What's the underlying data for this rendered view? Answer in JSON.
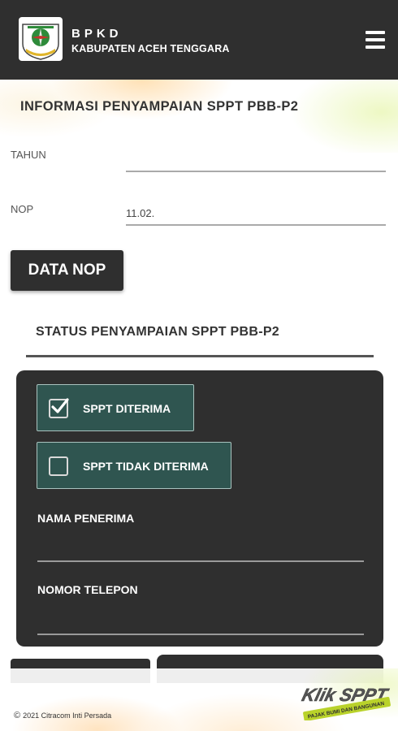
{
  "header": {
    "brand_line1": "BPKD",
    "brand_line2": "KABUPATEN ACEH TENGGARA",
    "logo_icon": "regency-emblem-icon",
    "menu_icon": "hamburger-menu-icon"
  },
  "page": {
    "title": "INFORMASI PENYAMPAIAN SPPT PBB-P2"
  },
  "form": {
    "tahun_label": "TAHUN",
    "tahun_value": "",
    "nop_label": "NOP",
    "nop_value": "11.02.",
    "data_nop_button": "DATA NOP"
  },
  "status": {
    "title": "STATUS PENYAMPAIAN SPPT PBB-P2",
    "options": [
      {
        "label": "SPPT DITERIMA",
        "checked": true
      },
      {
        "label": "SPPT TIDAK DITERIMA",
        "checked": false
      }
    ],
    "nama_penerima_label": "NAMA PENERIMA",
    "nama_penerima_value": "",
    "nomor_telepon_label": "NOMOR TELEPON",
    "nomor_telepon_value": ""
  },
  "footer": {
    "copyright": "2021 Citracom Inti Persada",
    "copyright_symbol": "©",
    "logo_text": "Klik SPPT",
    "logo_tagline": "PAJAK BUMI DAN BANGUNAN"
  },
  "colors": {
    "header_bg": "#2f2f2f",
    "option_bg": "#2f5550",
    "logo_green": "#b9d22a"
  }
}
